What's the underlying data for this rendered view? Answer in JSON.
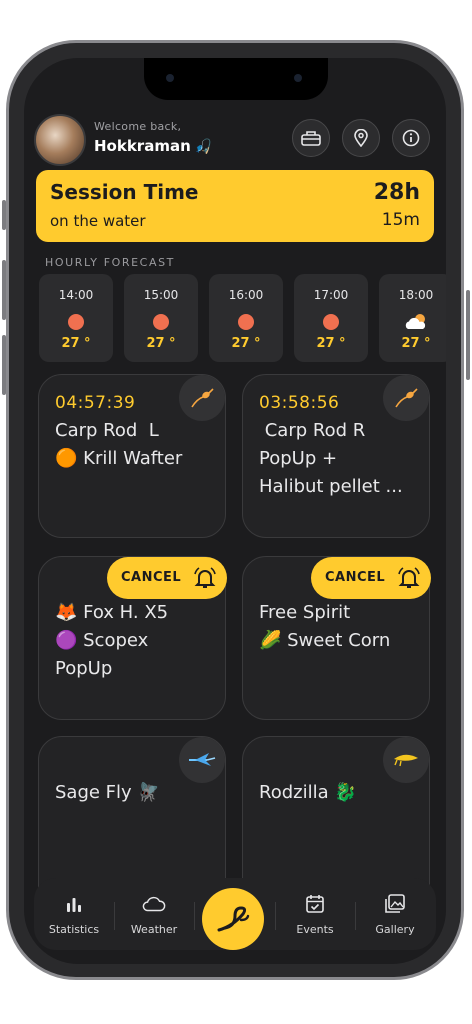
{
  "header": {
    "welcome": "Welcome back,",
    "username": "Hokkraman",
    "username_icon": "🎣",
    "buttons": [
      {
        "icon": "tackle-box-icon"
      },
      {
        "icon": "location-pin-icon"
      },
      {
        "icon": "info-icon"
      }
    ]
  },
  "session": {
    "title": "Session Time",
    "subtitle": "on the water",
    "hours": "28h",
    "minutes": "15m"
  },
  "forecast": {
    "title": "HOURLY FORECAST",
    "items": [
      {
        "time": "14:00",
        "icon": "sun-icon",
        "temp": "27 °"
      },
      {
        "time": "15:00",
        "icon": "sun-icon",
        "temp": "27 °"
      },
      {
        "time": "16:00",
        "icon": "sun-icon",
        "temp": "27 °"
      },
      {
        "time": "17:00",
        "icon": "sun-icon",
        "temp": "27 °"
      },
      {
        "time": "18:00",
        "icon": "partly-cloudy-icon",
        "temp": "27 °"
      }
    ]
  },
  "rods": [
    {
      "timer": "04:57:39",
      "name": "Carp Rod  L\n🟠 Krill Wafter",
      "icon": "bobber-icon"
    },
    {
      "timer": "03:58:56",
      "name": " Carp Rod R\nPopUp +\nHalibut pellet ...",
      "icon": "bobber-icon"
    },
    {
      "timer": "",
      "name": "🦊 Fox H. X5\n🟣 Scopex\nPopUp",
      "cancel": "CANCEL"
    },
    {
      "timer": "",
      "name": "Free Spirit\n🌽 Sweet Corn",
      "cancel": "CANCEL"
    },
    {
      "timer": "",
      "name": "Sage Fly 🪰",
      "icon": "fly-lure-icon"
    },
    {
      "timer": "",
      "name": "Rodzilla 🐉",
      "icon": "spoon-lure-icon"
    }
  ],
  "tabbar": {
    "tabs": [
      {
        "label": "Statistics",
        "icon": "bar-chart-icon"
      },
      {
        "label": "Weather",
        "icon": "cloud-icon"
      },
      {
        "label": "Events",
        "icon": "calendar-icon"
      },
      {
        "label": "Gallery",
        "icon": "gallery-icon"
      }
    ],
    "center_icon": "fishing-hook-icon"
  },
  "colors": {
    "accent": "#ffcb2e",
    "background": "#1c1c1e",
    "card": "#232325",
    "sun": "#f07050"
  }
}
